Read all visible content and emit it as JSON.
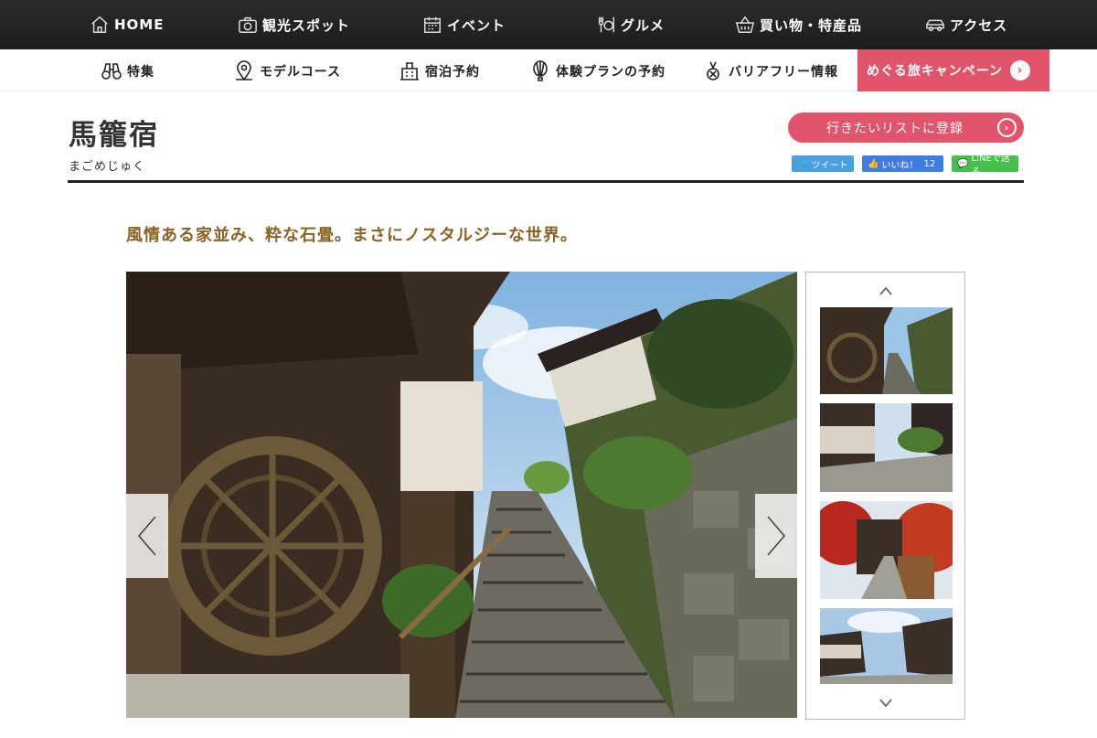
{
  "topnav": {
    "items": [
      {
        "label": "HOME",
        "icon": "home-icon"
      },
      {
        "label": "観光スポット",
        "icon": "camera-icon"
      },
      {
        "label": "イベント",
        "icon": "calendar-icon"
      },
      {
        "label": "グルメ",
        "icon": "cutlery-icon"
      },
      {
        "label": "買い物・特産品",
        "icon": "basket-icon"
      },
      {
        "label": "アクセス",
        "icon": "car-icon"
      }
    ]
  },
  "subnav": {
    "items": [
      {
        "label": "特集",
        "icon": "binoculars-icon"
      },
      {
        "label": "モデルコース",
        "icon": "map-pin-icon"
      },
      {
        "label": "宿泊予約",
        "icon": "hotel-icon"
      },
      {
        "label": "体験プランの予約",
        "icon": "balloon-icon"
      },
      {
        "label": "バリアフリー情報",
        "icon": "medal-icon"
      }
    ],
    "campaign": "めぐる旅キャンペーン"
  },
  "page": {
    "title": "馬籠宿",
    "kana": "まごめじゅく",
    "wishlist_button": "行きたいリストに登録",
    "catchcopy": "風情ある家並み、粋な石畳。まさにノスタルジーな世界。"
  },
  "social": {
    "tweet": "ツイート",
    "like": "いいね！",
    "like_count": "12",
    "line": "LINEで送る"
  },
  "colors": {
    "accent": "#e0556c",
    "catch": "#8a6324",
    "nav_bg": "#222222"
  }
}
